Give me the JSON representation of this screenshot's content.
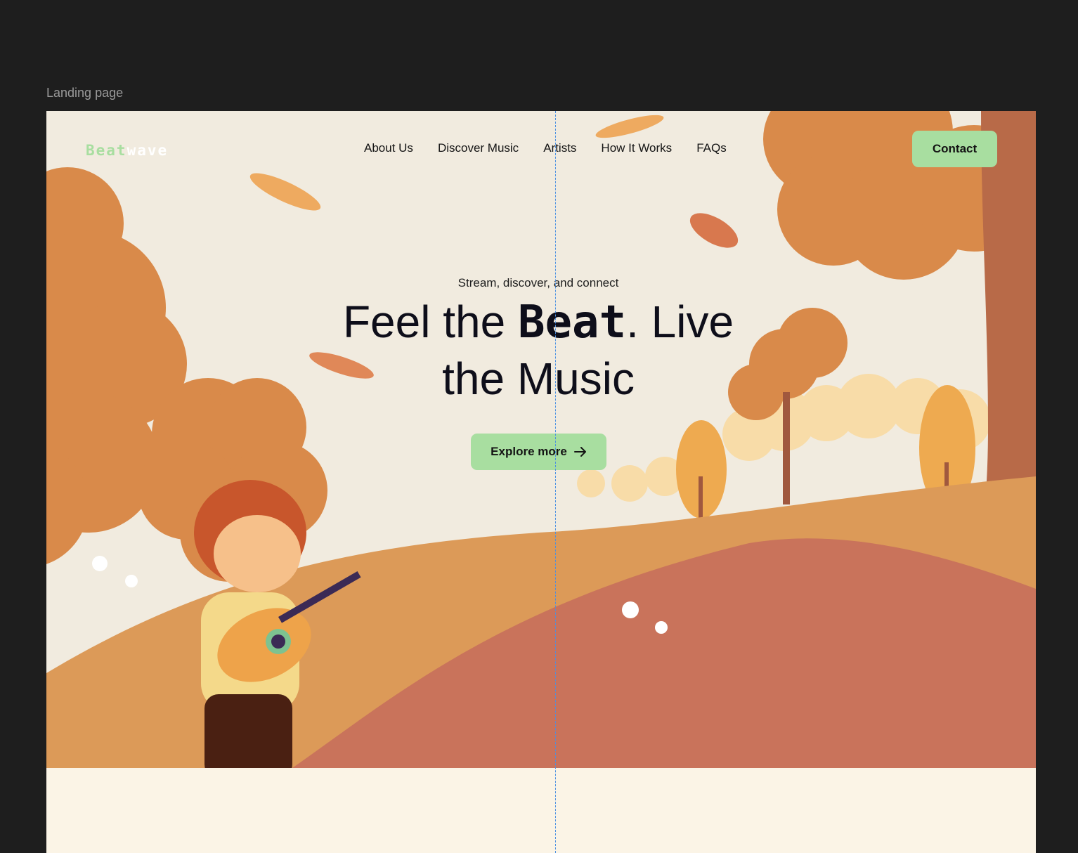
{
  "canvas": {
    "frame_label": "Landing page"
  },
  "brand": {
    "logo_part1": "Beat",
    "logo_part2": "wave"
  },
  "nav": {
    "links": [
      "About Us",
      "Discover Music",
      "Artists",
      "How It Works",
      "FAQs"
    ],
    "contact_label": "Contact"
  },
  "hero": {
    "subtitle": "Stream, discover, and connect",
    "title_part1": "Feel the ",
    "title_beat": "Beat",
    "title_part2": ". Live",
    "title_line2": "the Music",
    "cta_label": "Explore more",
    "cta_icon": "arrow-right-icon"
  },
  "colors": {
    "canvas_bg": "#1e1e1e",
    "sky": "#f1ebdf",
    "accent_green": "#a8dea0",
    "hill_orange": "#dc9a58",
    "hill_rust": "#c9735b",
    "tree_orange": "#d98a4a",
    "trunk": "#b86a48",
    "ground": "#fbf4e6"
  }
}
